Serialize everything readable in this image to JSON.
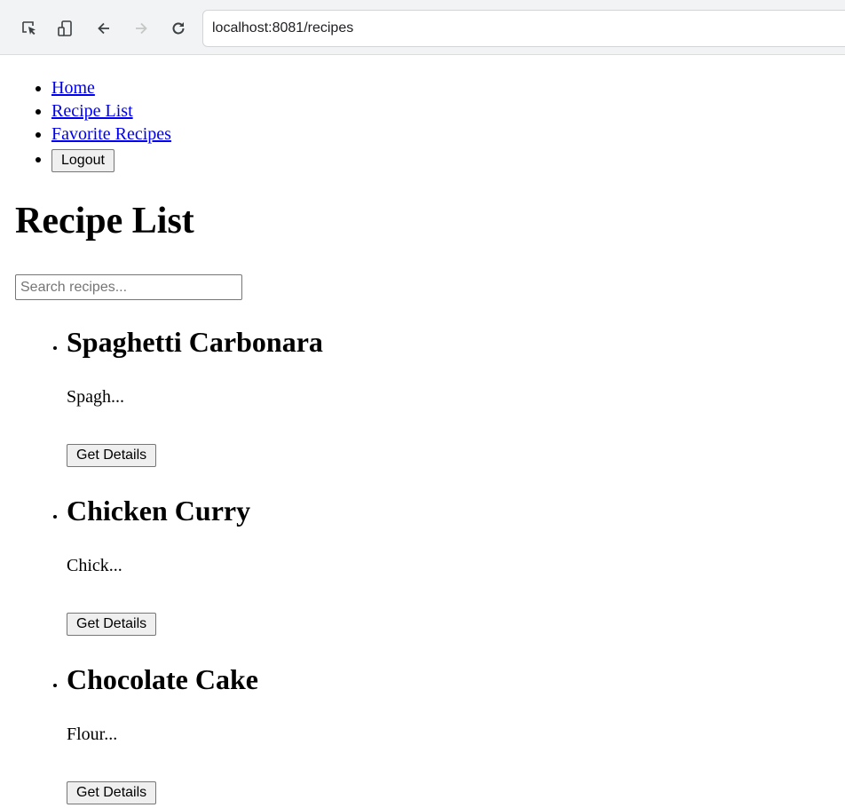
{
  "browser": {
    "url": "localhost:8081/recipes",
    "icons": [
      "inspect-icon",
      "device-toggle-icon",
      "back-arrow-icon",
      "forward-arrow-icon",
      "reload-icon"
    ]
  },
  "nav": {
    "items": [
      {
        "label": "Home"
      },
      {
        "label": "Recipe List"
      },
      {
        "label": "Favorite Recipes"
      }
    ],
    "logout_label": "Logout"
  },
  "main": {
    "title": "Recipe List",
    "search": {
      "placeholder": "Search recipes...",
      "value": ""
    },
    "recipes": [
      {
        "name": "Spaghetti Carbonara",
        "description": "Spagh...",
        "button_label": "Get Details"
      },
      {
        "name": "Chicken Curry",
        "description": "Chick...",
        "button_label": "Get Details"
      },
      {
        "name": "Chocolate Cake",
        "description": "Flour...",
        "button_label": "Get Details"
      }
    ]
  },
  "colors": {
    "link": "#0000ee",
    "toolbar_bg": "#f1f3f4",
    "button_bg": "#efefef"
  }
}
